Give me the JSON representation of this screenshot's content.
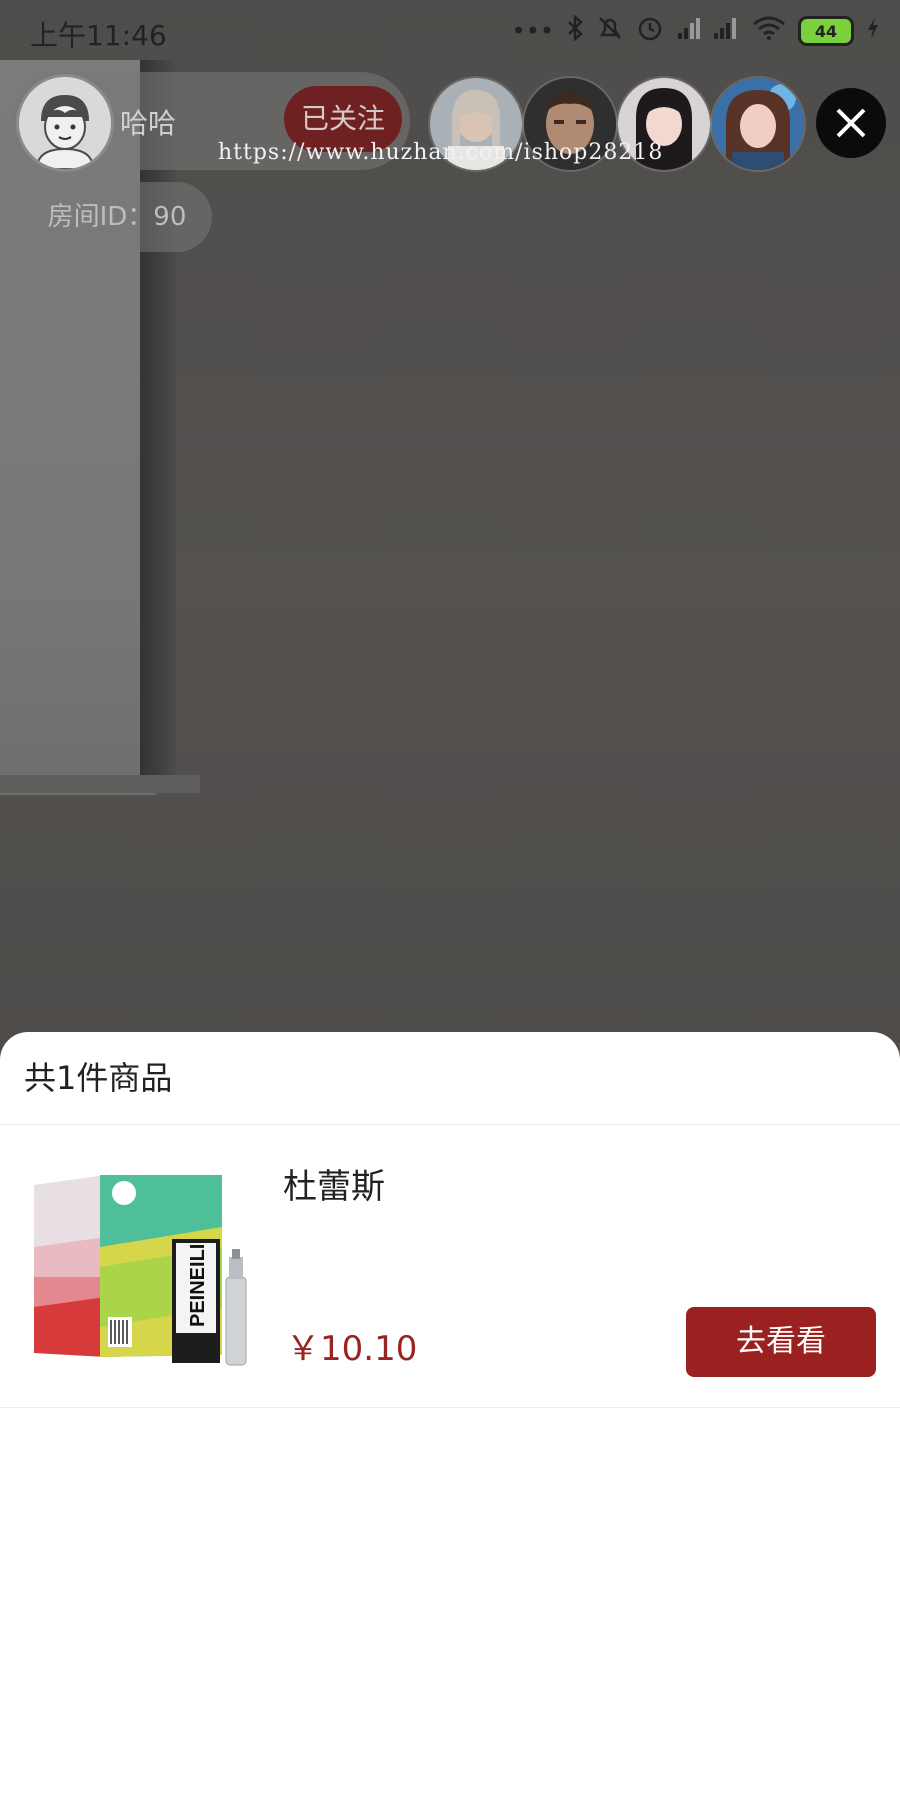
{
  "status_bar": {
    "time": "上午11:46",
    "battery": "44",
    "icons": [
      "more-dots-icon",
      "bluetooth-icon",
      "mute-icon",
      "alarm-icon",
      "signal-icon",
      "wifi-icon",
      "battery-icon",
      "charging-icon"
    ]
  },
  "host": {
    "name": "哈哈",
    "follow_label": "已关注",
    "room_id": "房间ID：90"
  },
  "viewers": [
    "viewer-avatar-1",
    "viewer-avatar-2",
    "viewer-avatar-3",
    "viewer-avatar-4"
  ],
  "watermark": "https://www.huzhan.com/ishop28218",
  "sheet": {
    "header": "共1件商品",
    "products": [
      {
        "name": "杜蕾斯",
        "price": "￥10.10",
        "action_label": "去看看",
        "image_text": "PEINEILI"
      }
    ]
  },
  "colors": {
    "accent": "#9b2120",
    "price": "#9a2424",
    "follow_bg": "#6f2020"
  }
}
